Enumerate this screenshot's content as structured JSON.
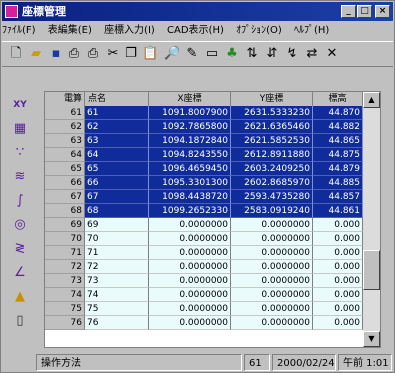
{
  "window": {
    "title": "座標管理"
  },
  "menu": [
    "ﾌｧｲﾙ(F)",
    "表編集(E)",
    "座標入力(I)",
    "CAD表示(H)",
    "ｵﾌﾟｼｮﾝ(O)",
    "ﾍﾙﾌﾟ(H)"
  ],
  "toolbar_icons": [
    "new-file-icon",
    "open-folder-icon",
    "save-icon",
    "print-preview-icon",
    "print-icon",
    "cut-icon",
    "copy-icon",
    "paste-icon",
    "find-icon",
    "edit-icon",
    "window-icon",
    "thumb-icon",
    "sort-ascending-icon",
    "sort-descending-icon",
    "convert-icon",
    "link-icon",
    "close-icon"
  ],
  "left_tools": [
    "xy-icon",
    "table-icon",
    "points-icon",
    "wave-icon",
    "curve-icon",
    "compass-icon",
    "zigzag-icon",
    "angle-icon",
    "triangle-icon",
    "document-icon"
  ],
  "table": {
    "headers": [
      "電算",
      "点名",
      "X座標",
      "Y座標",
      "標高"
    ],
    "rows": [
      {
        "no": "61",
        "name": "61",
        "x": "1091.8007900",
        "y": "2631.5333230",
        "z": "44.870",
        "selected": true
      },
      {
        "no": "62",
        "name": "62",
        "x": "1092.7865800",
        "y": "2621.6365460",
        "z": "44.882",
        "selected": true
      },
      {
        "no": "63",
        "name": "63",
        "x": "1094.1872840",
        "y": "2621.5852530",
        "z": "44.865",
        "selected": true
      },
      {
        "no": "64",
        "name": "64",
        "x": "1094.8243550",
        "y": "2612.8911880",
        "z": "44.875",
        "selected": true
      },
      {
        "no": "65",
        "name": "65",
        "x": "1096.4659450",
        "y": "2603.2409250",
        "z": "44.879",
        "selected": true
      },
      {
        "no": "66",
        "name": "66",
        "x": "1095.3301300",
        "y": "2602.8685970",
        "z": "44.885",
        "selected": true
      },
      {
        "no": "67",
        "name": "67",
        "x": "1098.4438720",
        "y": "2593.4735280",
        "z": "44.857",
        "selected": true
      },
      {
        "no": "68",
        "name": "68",
        "x": "1099.2652330",
        "y": "2583.0919240",
        "z": "44.861",
        "selected": true
      },
      {
        "no": "69",
        "name": "69",
        "x": "0.0000000",
        "y": "0.0000000",
        "z": "0.000",
        "selected": false
      },
      {
        "no": "70",
        "name": "70",
        "x": "0.0000000",
        "y": "0.0000000",
        "z": "0.000",
        "selected": false
      },
      {
        "no": "71",
        "name": "71",
        "x": "0.0000000",
        "y": "0.0000000",
        "z": "0.000",
        "selected": false
      },
      {
        "no": "72",
        "name": "72",
        "x": "0.0000000",
        "y": "0.0000000",
        "z": "0.000",
        "selected": false
      },
      {
        "no": "73",
        "name": "73",
        "x": "0.0000000",
        "y": "0.0000000",
        "z": "0.000",
        "selected": false
      },
      {
        "no": "74",
        "name": "74",
        "x": "0.0000000",
        "y": "0.0000000",
        "z": "0.000",
        "selected": false
      },
      {
        "no": "75",
        "name": "75",
        "x": "0.0000000",
        "y": "0.0000000",
        "z": "0.000",
        "selected": false
      },
      {
        "no": "76",
        "name": "76",
        "x": "0.0000000",
        "y": "0.0000000",
        "z": "0.000",
        "selected": false
      }
    ]
  },
  "status": {
    "label": "操作方法",
    "count": "61",
    "date": "2000/02/24",
    "time": "午前 1:01"
  }
}
